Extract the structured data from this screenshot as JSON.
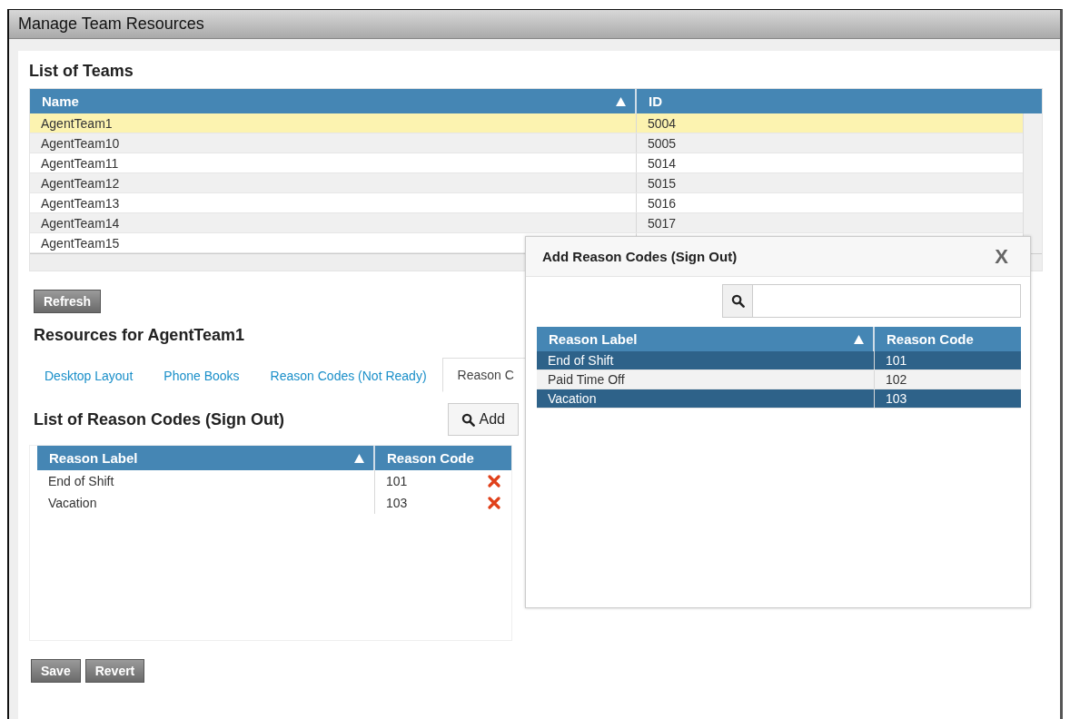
{
  "window": {
    "title": "Manage Team Resources"
  },
  "teams": {
    "title": "List of Teams",
    "columns": [
      {
        "label": "Name",
        "sorted": true
      },
      {
        "label": "ID",
        "sorted": false
      }
    ],
    "rows": [
      {
        "name": "AgentTeam1",
        "id": "5004",
        "selected": true
      },
      {
        "name": "AgentTeam10",
        "id": "5005",
        "selected": false
      },
      {
        "name": "AgentTeam11",
        "id": "5014",
        "selected": false
      },
      {
        "name": "AgentTeam12",
        "id": "5015",
        "selected": false
      },
      {
        "name": "AgentTeam13",
        "id": "5016",
        "selected": false
      },
      {
        "name": "AgentTeam14",
        "id": "5017",
        "selected": false
      },
      {
        "name": "AgentTeam15",
        "selected": false
      }
    ]
  },
  "refresh_button": "Refresh",
  "resources": {
    "title": "Resources for AgentTeam1",
    "tabs": [
      {
        "label": "Desktop Layout",
        "selected": false
      },
      {
        "label": "Phone Books",
        "selected": false
      },
      {
        "label": "Reason Codes (Not Ready)",
        "selected": false
      },
      {
        "label": "Reason C",
        "selected": true
      }
    ],
    "list_title": "List of Reason Codes (Sign Out)",
    "add_button": "Add",
    "columns": [
      {
        "label": "Reason Label",
        "sorted": true
      },
      {
        "label": "Reason Code",
        "sorted": false
      }
    ],
    "rows": [
      {
        "label": "End of Shift",
        "code": "101"
      },
      {
        "label": "Vacation",
        "code": "103"
      }
    ]
  },
  "buttons": [
    "Save",
    "Revert"
  ],
  "dialog": {
    "title": "Add Reason Codes (Sign Out)",
    "close": "X",
    "columns": [
      {
        "label": "Reason Label",
        "sorted": true
      },
      {
        "label": "Reason Code",
        "sorted": false
      }
    ],
    "rows": [
      {
        "label": "End of Shift",
        "code": "101",
        "selected": true
      },
      {
        "label": "Paid Time Off",
        "code": "102",
        "selected": false
      },
      {
        "label": "Vacation",
        "code": "103",
        "selected": true
      }
    ]
  }
}
